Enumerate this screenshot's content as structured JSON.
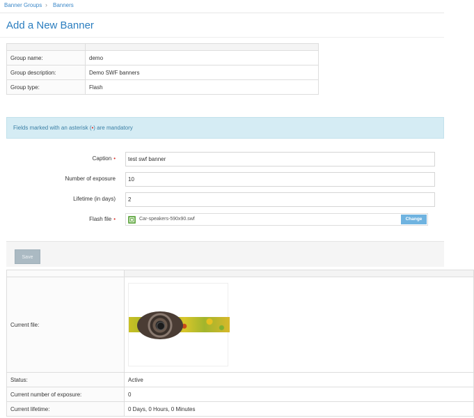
{
  "breadcrumb": {
    "items": [
      "Banner Groups",
      "Banners"
    ],
    "separator": "›"
  },
  "page": {
    "title": "Add a New Banner"
  },
  "group_info": {
    "rows": [
      {
        "label": "Group name:",
        "value": "demo"
      },
      {
        "label": "Group description:",
        "value": "Demo SWF banners"
      },
      {
        "label": "Group type:",
        "value": "Flash"
      }
    ]
  },
  "notice": {
    "before": "Fields marked with an asterisk (",
    "asterisk": "•",
    "after": ") are mandatory"
  },
  "form": {
    "caption": {
      "label": "Caption",
      "value": "test swf banner",
      "required_mark": "•"
    },
    "exposure": {
      "label": "Number of exposure",
      "value": "10"
    },
    "lifetime": {
      "label": "Lifetime (in days)",
      "value": "2"
    },
    "flash_file": {
      "label": "Flash file",
      "filename": "Car-speakers-590x90.swf",
      "change_label": "Change",
      "required_mark": "•",
      "icon": "film-icon"
    },
    "save_label": "Save"
  },
  "details": {
    "current_file_label": "Current file:",
    "status": {
      "label": "Status:",
      "value": "Active"
    },
    "exposures": {
      "label": "Current number of exposure:",
      "value": "0"
    },
    "lifetime": {
      "label": "Current lifetime:",
      "value": "0 Days, 0 Hours, 0 Minutes"
    }
  },
  "colors": {
    "accent": "#2a7dbf",
    "link": "#3a87c8",
    "required": "#d9322b",
    "notice_bg": "#d5ecf4",
    "change_button": "#6fb3e0",
    "save_button": "#abbac3"
  }
}
